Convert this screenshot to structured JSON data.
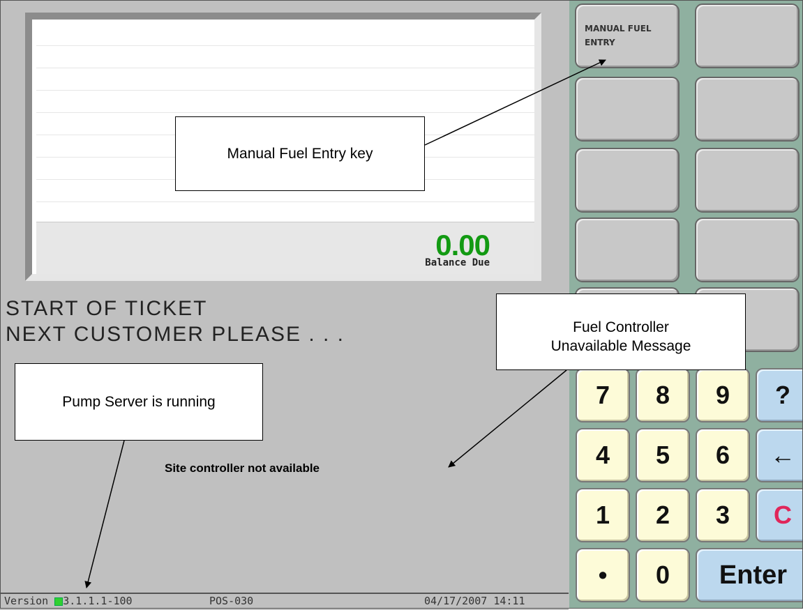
{
  "receipt": {
    "balance_amount": "0.00",
    "balance_label": "Balance Due"
  },
  "prompt": {
    "line1": "START OF TICKET",
    "line2": "NEXT CUSTOMER PLEASE . . ."
  },
  "message": "Site controller not available",
  "status": {
    "version_prefix": "Version ",
    "version_number": "3.1.1.1-100",
    "pos": "POS-030",
    "datetime": "04/17/2007 14:11",
    "pump_led_color": "#30d030"
  },
  "function_keys": {
    "manual_fuel_entry": "MANUAL FUEL ENTRY"
  },
  "keypad": {
    "k7": "7",
    "k8": "8",
    "k9": "9",
    "help": "?",
    "k4": "4",
    "k5": "5",
    "k6": "6",
    "backspace": "←",
    "k1": "1",
    "k2": "2",
    "k3": "3",
    "clear": "C",
    "decimal": "•",
    "k0": "0",
    "enter": "Enter"
  },
  "callouts": {
    "manual_fuel_key": "Manual Fuel Entry key",
    "fuel_controller_line1": "Fuel Controller",
    "fuel_controller_line2": "Unavailable Message",
    "pump_server": "Pump Server is running"
  },
  "colors": {
    "balance_green": "#129a12",
    "keypad_panel": "#8fb0a0",
    "clear_red": "#e0265a",
    "blue_key": "#bcd8ee"
  }
}
